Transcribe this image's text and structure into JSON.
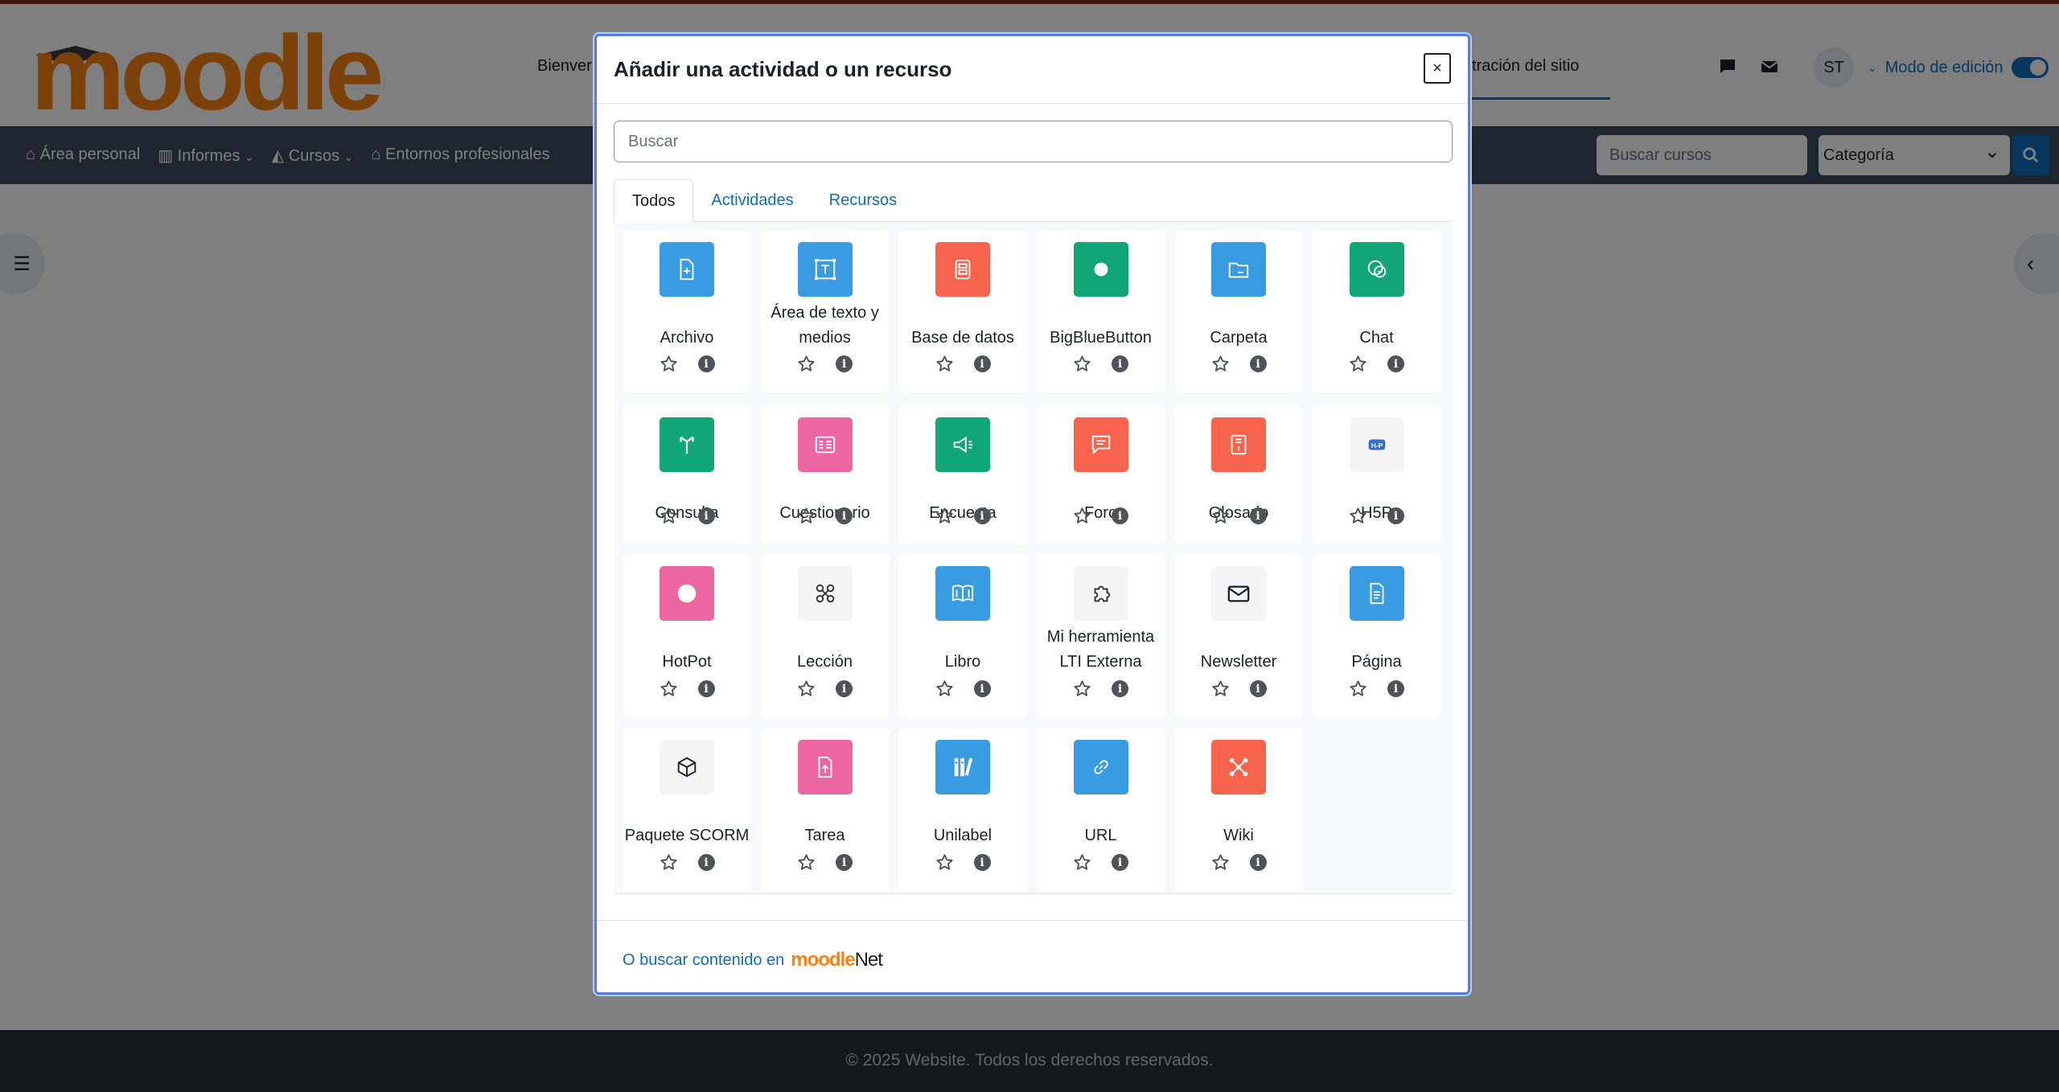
{
  "header": {
    "logo_text": "moodle",
    "nav_partial": "Bienver",
    "admin_partial": "inistración del sitio",
    "avatar_initials": "ST",
    "edit_mode_label": "Modo de edición"
  },
  "navbar": {
    "items": [
      "Área personal",
      "Informes",
      "Cursos",
      "Entornos profesionales"
    ],
    "course_search_placeholder": "Buscar cursos",
    "category_value": "Categoría"
  },
  "footer": {
    "text": "© 2025 Website. Todos los derechos reservados."
  },
  "modal": {
    "title": "Añadir una actividad o un recurso",
    "close_label": "×",
    "search_placeholder": "Buscar",
    "tabs": [
      "Todos",
      "Actividades",
      "Recursos"
    ],
    "active_tab": "Todos",
    "items": [
      {
        "name": "Archivo",
        "color": "#399be2",
        "icon": "file-icon"
      },
      {
        "name": "Área de texto y medios",
        "color": "#399be2",
        "icon": "text-media-icon"
      },
      {
        "name": "Base de datos",
        "color": "#f7634d",
        "icon": "database-icon"
      },
      {
        "name": "BigBlueButton",
        "color": "#11a676",
        "icon": "bigbluebutton-icon"
      },
      {
        "name": "Carpeta",
        "color": "#399be2",
        "icon": "folder-icon"
      },
      {
        "name": "Chat",
        "color": "#11a676",
        "icon": "chat-icon"
      },
      {
        "name": "Consulta",
        "color": "#11a676",
        "icon": "choice-icon"
      },
      {
        "name": "Cuestionario",
        "color": "#eb66a2",
        "icon": "quiz-icon"
      },
      {
        "name": "Encuesta",
        "color": "#11a676",
        "icon": "survey-icon"
      },
      {
        "name": "Foro",
        "color": "#f7634d",
        "icon": "forum-icon"
      },
      {
        "name": "Glosario",
        "color": "#f7634d",
        "icon": "glossary-icon"
      },
      {
        "name": "H5P",
        "color": "#f5f5f5",
        "icon": "h5p-icon"
      },
      {
        "name": "HotPot",
        "color": "#eb66a2",
        "icon": "hotpot-icon"
      },
      {
        "name": "Lección",
        "color": "#f5f5f5",
        "icon": "lesson-icon"
      },
      {
        "name": "Libro",
        "color": "#399be2",
        "icon": "book-icon"
      },
      {
        "name": "Mi herramienta LTI Externa",
        "color": "#f5f5f5",
        "icon": "puzzle-icon"
      },
      {
        "name": "Newsletter",
        "color": "#f5f5f5",
        "icon": "envelope-icon"
      },
      {
        "name": "Página",
        "color": "#399be2",
        "icon": "page-icon"
      },
      {
        "name": "Paquete SCORM",
        "color": "#f5f5f5",
        "icon": "package-icon"
      },
      {
        "name": "Tarea",
        "color": "#eb66a2",
        "icon": "assignment-icon"
      },
      {
        "name": "Unilabel",
        "color": "#399be2",
        "icon": "unilabel-icon"
      },
      {
        "name": "URL",
        "color": "#399be2",
        "icon": "link-icon"
      },
      {
        "name": "Wiki",
        "color": "#f7634d",
        "icon": "wiki-icon"
      }
    ],
    "footer_text": "O buscar contenido en",
    "moodlenet_logo_a": "moodle",
    "moodlenet_logo_b": "Net"
  }
}
